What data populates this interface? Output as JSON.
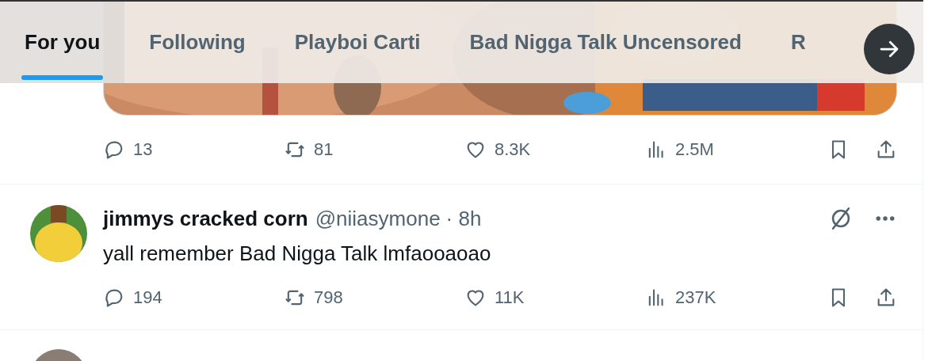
{
  "tabs": [
    {
      "label": "For you",
      "selected": true
    },
    {
      "label": "Following",
      "selected": false
    },
    {
      "label": "Playboi Carti",
      "selected": false
    },
    {
      "label": "Bad Nigga Talk Uncensored",
      "selected": false
    },
    {
      "label": "R",
      "selected": false
    }
  ],
  "posts": [
    {
      "kind": "media",
      "actions": {
        "replies": "13",
        "reposts": "81",
        "likes": "8.3K",
        "views": "2.5M"
      }
    },
    {
      "kind": "post",
      "author": {
        "name": "jimmys cracked corn",
        "handle": "@niiasymone",
        "time": "· 8h"
      },
      "text": "yall remember Bad Nigga Talk lmfaooaoao",
      "actions": {
        "replies": "194",
        "reposts": "798",
        "likes": "11K",
        "views": "237K"
      }
    },
    {
      "kind": "peek"
    }
  ]
}
